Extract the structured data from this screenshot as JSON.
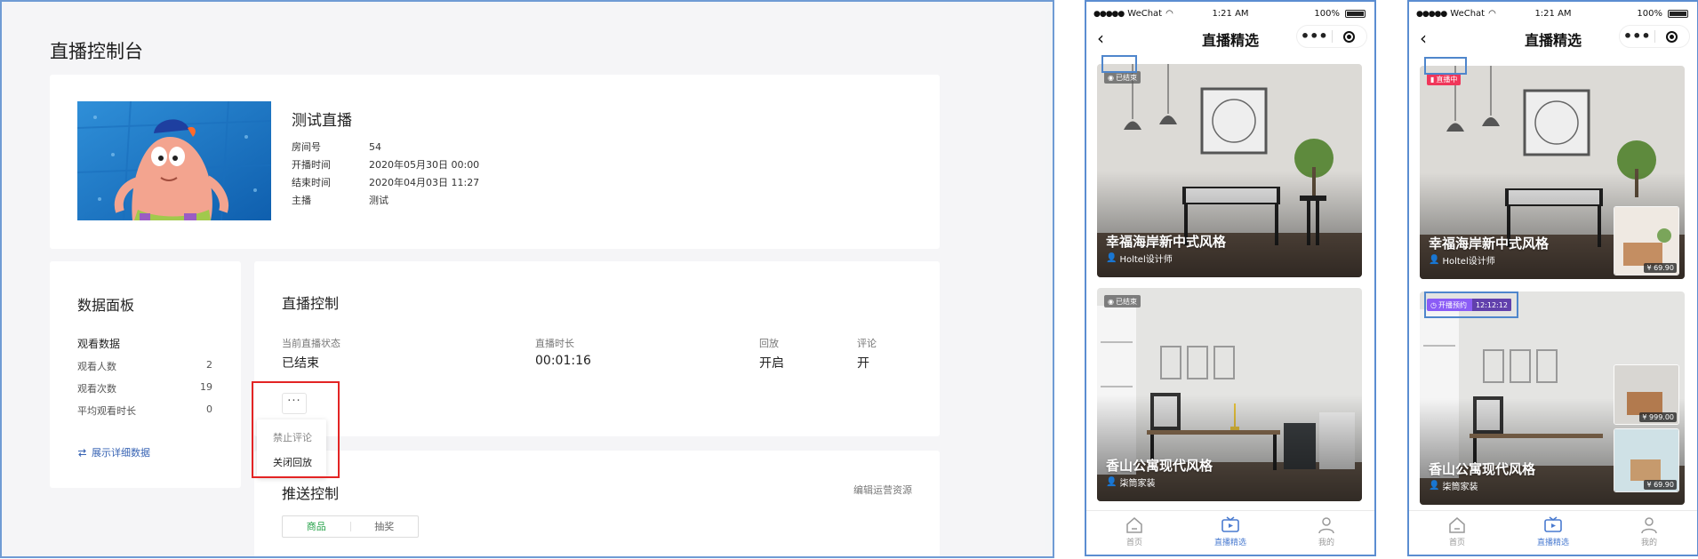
{
  "console": {
    "title": "直播控制台",
    "live": {
      "name": "测试直播",
      "rows": [
        {
          "label": "房间号",
          "value": "54"
        },
        {
          "label": "开播时间",
          "value": "2020年05月30日 00:00"
        },
        {
          "label": "结束时间",
          "value": "2020年04月03日 11:27"
        },
        {
          "label": "主播",
          "value": "测试"
        }
      ]
    },
    "data_panel": {
      "title": "数据面板",
      "subtitle": "观看数据",
      "stats": [
        {
          "label": "观看人数",
          "value": "2"
        },
        {
          "label": "观看次数",
          "value": "19"
        },
        {
          "label": "平均观看时长",
          "value": "0"
        }
      ],
      "detail_link": "展示详细数据"
    },
    "live_control": {
      "title": "直播控制",
      "fields": [
        {
          "label": "当前直播状态",
          "value": "已结束"
        },
        {
          "label": "直播时长",
          "value": "00:01:16"
        },
        {
          "label": "回放",
          "value": "开启"
        },
        {
          "label": "评论",
          "value": "开"
        }
      ],
      "more_label": "···",
      "menu": [
        "禁止评论",
        "关闭回放"
      ]
    },
    "push_control": {
      "title": "推送控制",
      "edit_link": "编辑运营资源",
      "tabs": [
        "商品",
        "抽奖"
      ]
    }
  },
  "phone": {
    "carrier": "WeChat",
    "time": "1:21 AM",
    "battery": "100%",
    "nav_title": "直播精选",
    "capsule_more": "•••",
    "tabs": [
      "首页",
      "直播精选",
      "我的"
    ]
  },
  "phone1": {
    "cards": [
      {
        "badge": "已结束",
        "title": "幸福海岸新中式风格",
        "author": "Holtel设计师"
      },
      {
        "badge": "已结束",
        "title": "香山公寓现代风格",
        "author": "柒筒家装"
      }
    ]
  },
  "phone2": {
    "cards": [
      {
        "badge": "直播中",
        "title": "幸福海岸新中式风格",
        "author": "Holtel设计师",
        "prices": [
          "¥ 69.90"
        ]
      },
      {
        "badge": "开播预约",
        "badge_time": "12:12:12",
        "title": "香山公寓现代风格",
        "author": "柒筒家装",
        "prices": [
          "¥ 999.00",
          "¥ 69.90"
        ]
      }
    ]
  },
  "colors": {
    "accent_blue": "#4a7bd0",
    "live_red": "#f0365a",
    "reserve_purple": "#8b5cf6",
    "highlight_red": "#e32424",
    "tab_green": "#27a34a"
  }
}
